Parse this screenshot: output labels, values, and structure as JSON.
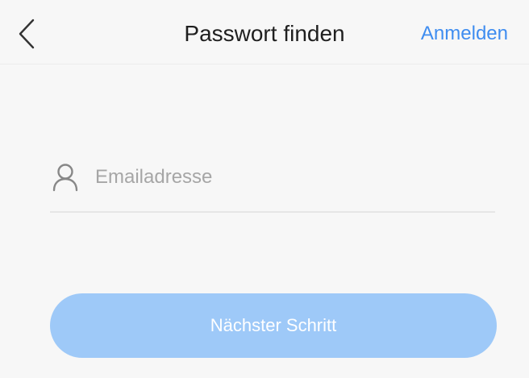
{
  "header": {
    "title": "Passwort finden",
    "login_label": "Anmelden"
  },
  "form": {
    "email": {
      "placeholder": "Emailadresse",
      "value": ""
    },
    "next_label": "Nächster Schritt"
  },
  "icons": {
    "back": "chevron-left-icon",
    "user": "user-icon"
  },
  "colors": {
    "background": "#f7f7f7",
    "accent": "#3f8df0",
    "button_disabled": "#9ec9f8",
    "title": "#1f1f1f",
    "placeholder": "#a6a6a6"
  }
}
